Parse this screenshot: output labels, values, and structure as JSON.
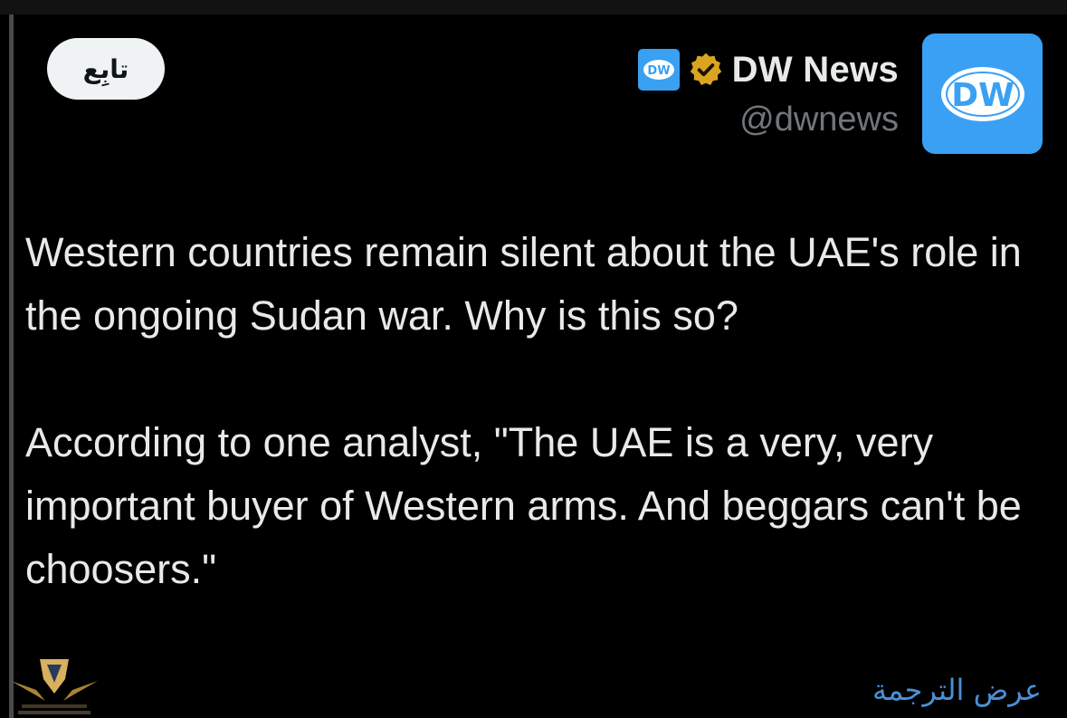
{
  "header": {
    "follow_label": "تابِع",
    "display_name": "DW News",
    "handle": "@dwnews",
    "mini_logo_text": "DW",
    "avatar_logo_text": "DW",
    "verified_icon": "verified-badge-icon"
  },
  "tweet": {
    "paragraph_1": "Western countries remain silent about the UAE's role in the ongoing Sudan war. Why is this so?",
    "paragraph_2": "According to one analyst, \"The UAE is a very, very important buyer of Western arms. And beggars can't be choosers.\""
  },
  "footer": {
    "translate_label": "عرض الترجمة"
  },
  "colors": {
    "background": "#000000",
    "text": "#e7e9ea",
    "muted": "#71767b",
    "brand_blue": "#3aa0f3",
    "verified_gold": "#d9a520",
    "link": "#4a8fd6",
    "follow_bg": "#eff3f4"
  }
}
